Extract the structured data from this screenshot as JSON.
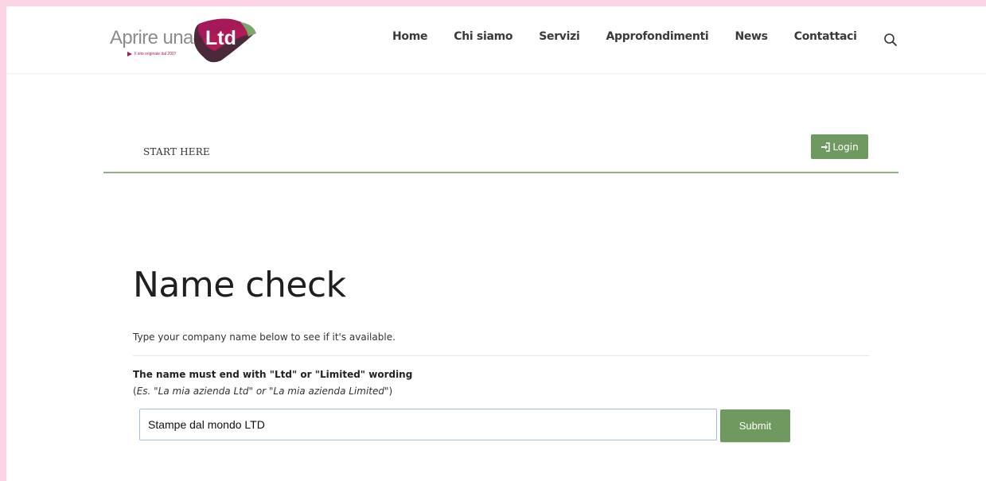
{
  "logo": {
    "text": "Aprire una",
    "badge": "Ltd",
    "tagline": "Il sito originale dal 2007"
  },
  "nav": {
    "items": [
      "Home",
      "Chi siamo",
      "Servizi",
      "Approfondimenti",
      "News",
      "Contattaci"
    ],
    "search_icon": "search-icon"
  },
  "start_bar": {
    "label": "START HERE",
    "login_label": "Login",
    "login_icon": "sign-in-icon"
  },
  "main": {
    "title": "Name check",
    "intro": "Type your company name below to see if it's available.",
    "rule": "The name must end with \"Ltd\" or \"Limited\" wording",
    "example_open": "(",
    "example_text": "Es. \"La mia azienda Ltd\" or \"La mia azienda Limited\"",
    "example_close": ")",
    "input_value": "Stampe dal mondo LTD",
    "submit_label": "Submit"
  },
  "colors": {
    "accent_green": "#6f9a5f",
    "brand_magenta": "#a5195a",
    "brand_dark": "#4a2a3a",
    "background_pink": "#fbd3e4"
  }
}
